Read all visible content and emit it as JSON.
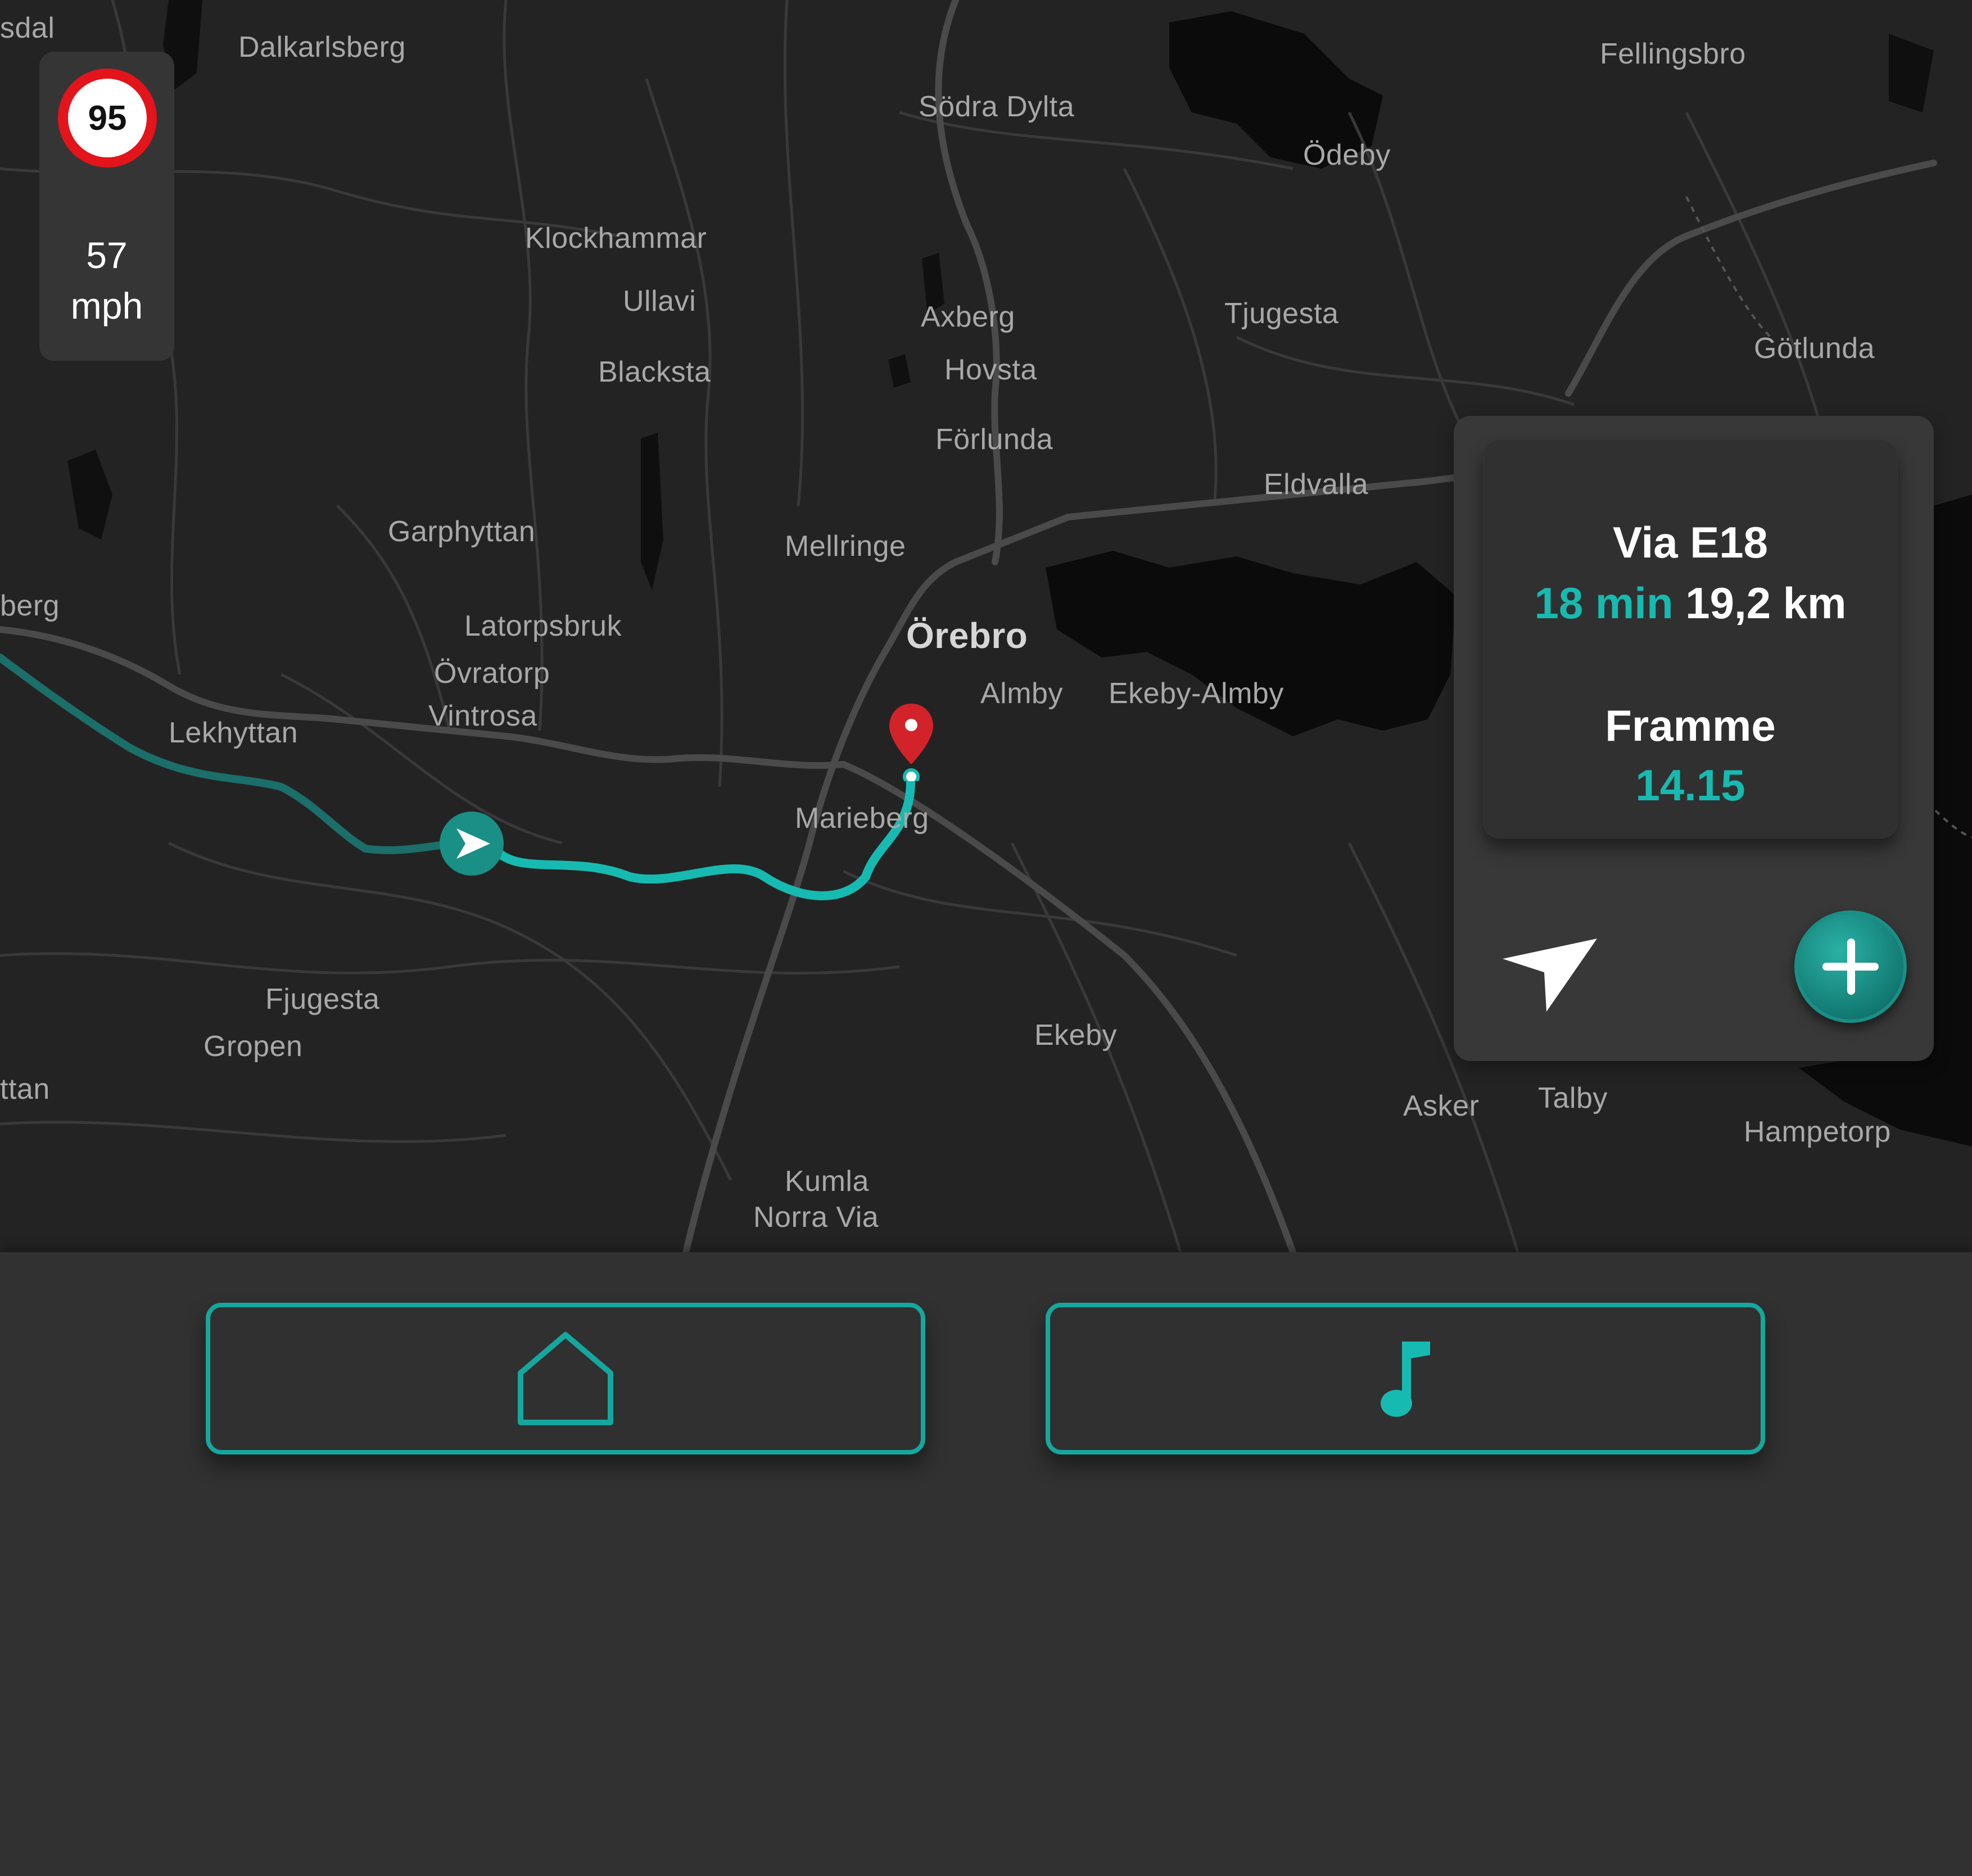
{
  "map": {
    "places": [
      "sdal",
      "Dalkarlsberg",
      "Fellingsbro",
      "Södra Dylta",
      "Ödeby",
      "Klockhammar",
      "Ullavi",
      "Axberg",
      "Tjugesta",
      "Götlunda",
      "Blacksta",
      "Hovsta",
      "Förlunda",
      "Eldvalla",
      "Garphyttan",
      "Mellringe",
      "berg",
      "Latorpsbruk",
      "Örebro",
      "Övratorp",
      "Almby",
      "Ekeby-Almby",
      "Vintrosa",
      "Lekhyttan",
      "Marieberg",
      "Fjugesta",
      "Gropen",
      "Ekeby",
      "ttan",
      "Asker",
      "Talby",
      "Hampetorp",
      "Kumla",
      "Norra Via"
    ],
    "current_location_icon": "navigation-arrow-icon",
    "destination_icon": "map-pin-icon",
    "route_color": "#17bab0"
  },
  "speed": {
    "limit": "95",
    "current": "57",
    "unit": "mph"
  },
  "route": {
    "via": "Via E18",
    "duration": "18 min",
    "distance": "19,2 km",
    "arrival_label": "Framme",
    "arrival_time": "14.15"
  },
  "controls": {
    "recenter_icon": "location-arrow-icon",
    "add_icon": "plus-icon"
  },
  "bottom_nav": {
    "home_icon": "home-icon",
    "music_icon": "music-note-icon"
  },
  "colors": {
    "accent": "#17bab0",
    "pin": "#d2232a",
    "map_background": "#232323",
    "panel": "#383838"
  }
}
